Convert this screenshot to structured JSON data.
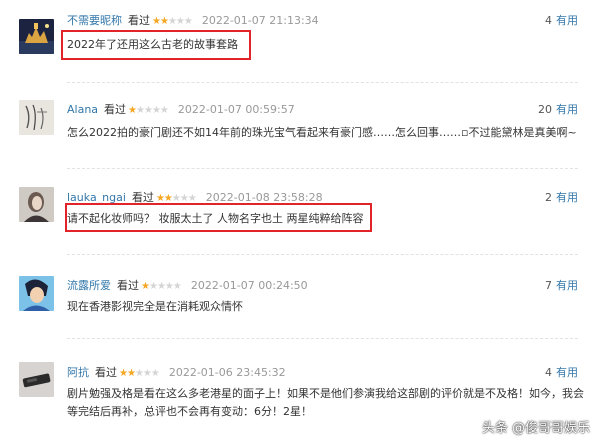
{
  "reviews": [
    {
      "username": "不需要昵称",
      "watched": "看过",
      "stars_filled": 2,
      "stars_total": 5,
      "date": "2022-01-07 21:13:34",
      "votes": "4",
      "votes_label": "有用",
      "content": "2022年了还用这么古老的故事套路"
    },
    {
      "username": "Alana",
      "watched": "看过",
      "stars_filled": 1,
      "stars_total": 5,
      "date": "2022-01-07 00:59:57",
      "votes": "20",
      "votes_label": "有用",
      "content": "怎么2022拍的豪门剧还不如14年前的珠光宝气看起来有豪门感……怎么回事……▫不过能黛林是真美啊~"
    },
    {
      "username": "lauka_ngai",
      "watched": "看过",
      "stars_filled": 2,
      "stars_total": 5,
      "date": "2022-01-08 23:58:28",
      "votes": "2",
      "votes_label": "有用",
      "content": "请不起化妆师吗？ 妆服太土了 人物名字也土 两星纯粹给阵容"
    },
    {
      "username": "流露所爱",
      "watched": "看过",
      "stars_filled": 1,
      "stars_total": 5,
      "date": "2022-01-07 00:24:50",
      "votes": "7",
      "votes_label": "有用",
      "content": "现在香港影视完全是在消耗观众情怀"
    },
    {
      "username": "阿抗",
      "watched": "看过",
      "stars_filled": 2,
      "stars_total": 5,
      "date": "2022-01-06 23:45:32",
      "votes": "4",
      "votes_label": "有用",
      "content_lines": [
        "剧片勉强及格是看在这么多老港星的面子上！如果不是他们参演我给这部剧的评价就是不及格！如今，我会",
        "等完结后再补，总评也不会再有变动：6分！2星！"
      ]
    }
  ],
  "watermark": "头条 @俊哥哥娱乐",
  "colors": {
    "username": "#3377aa",
    "star_on": "#f5a623",
    "star_off": "#d5d5d5",
    "highlight_box": "#e2232a",
    "date": "#999999"
  }
}
